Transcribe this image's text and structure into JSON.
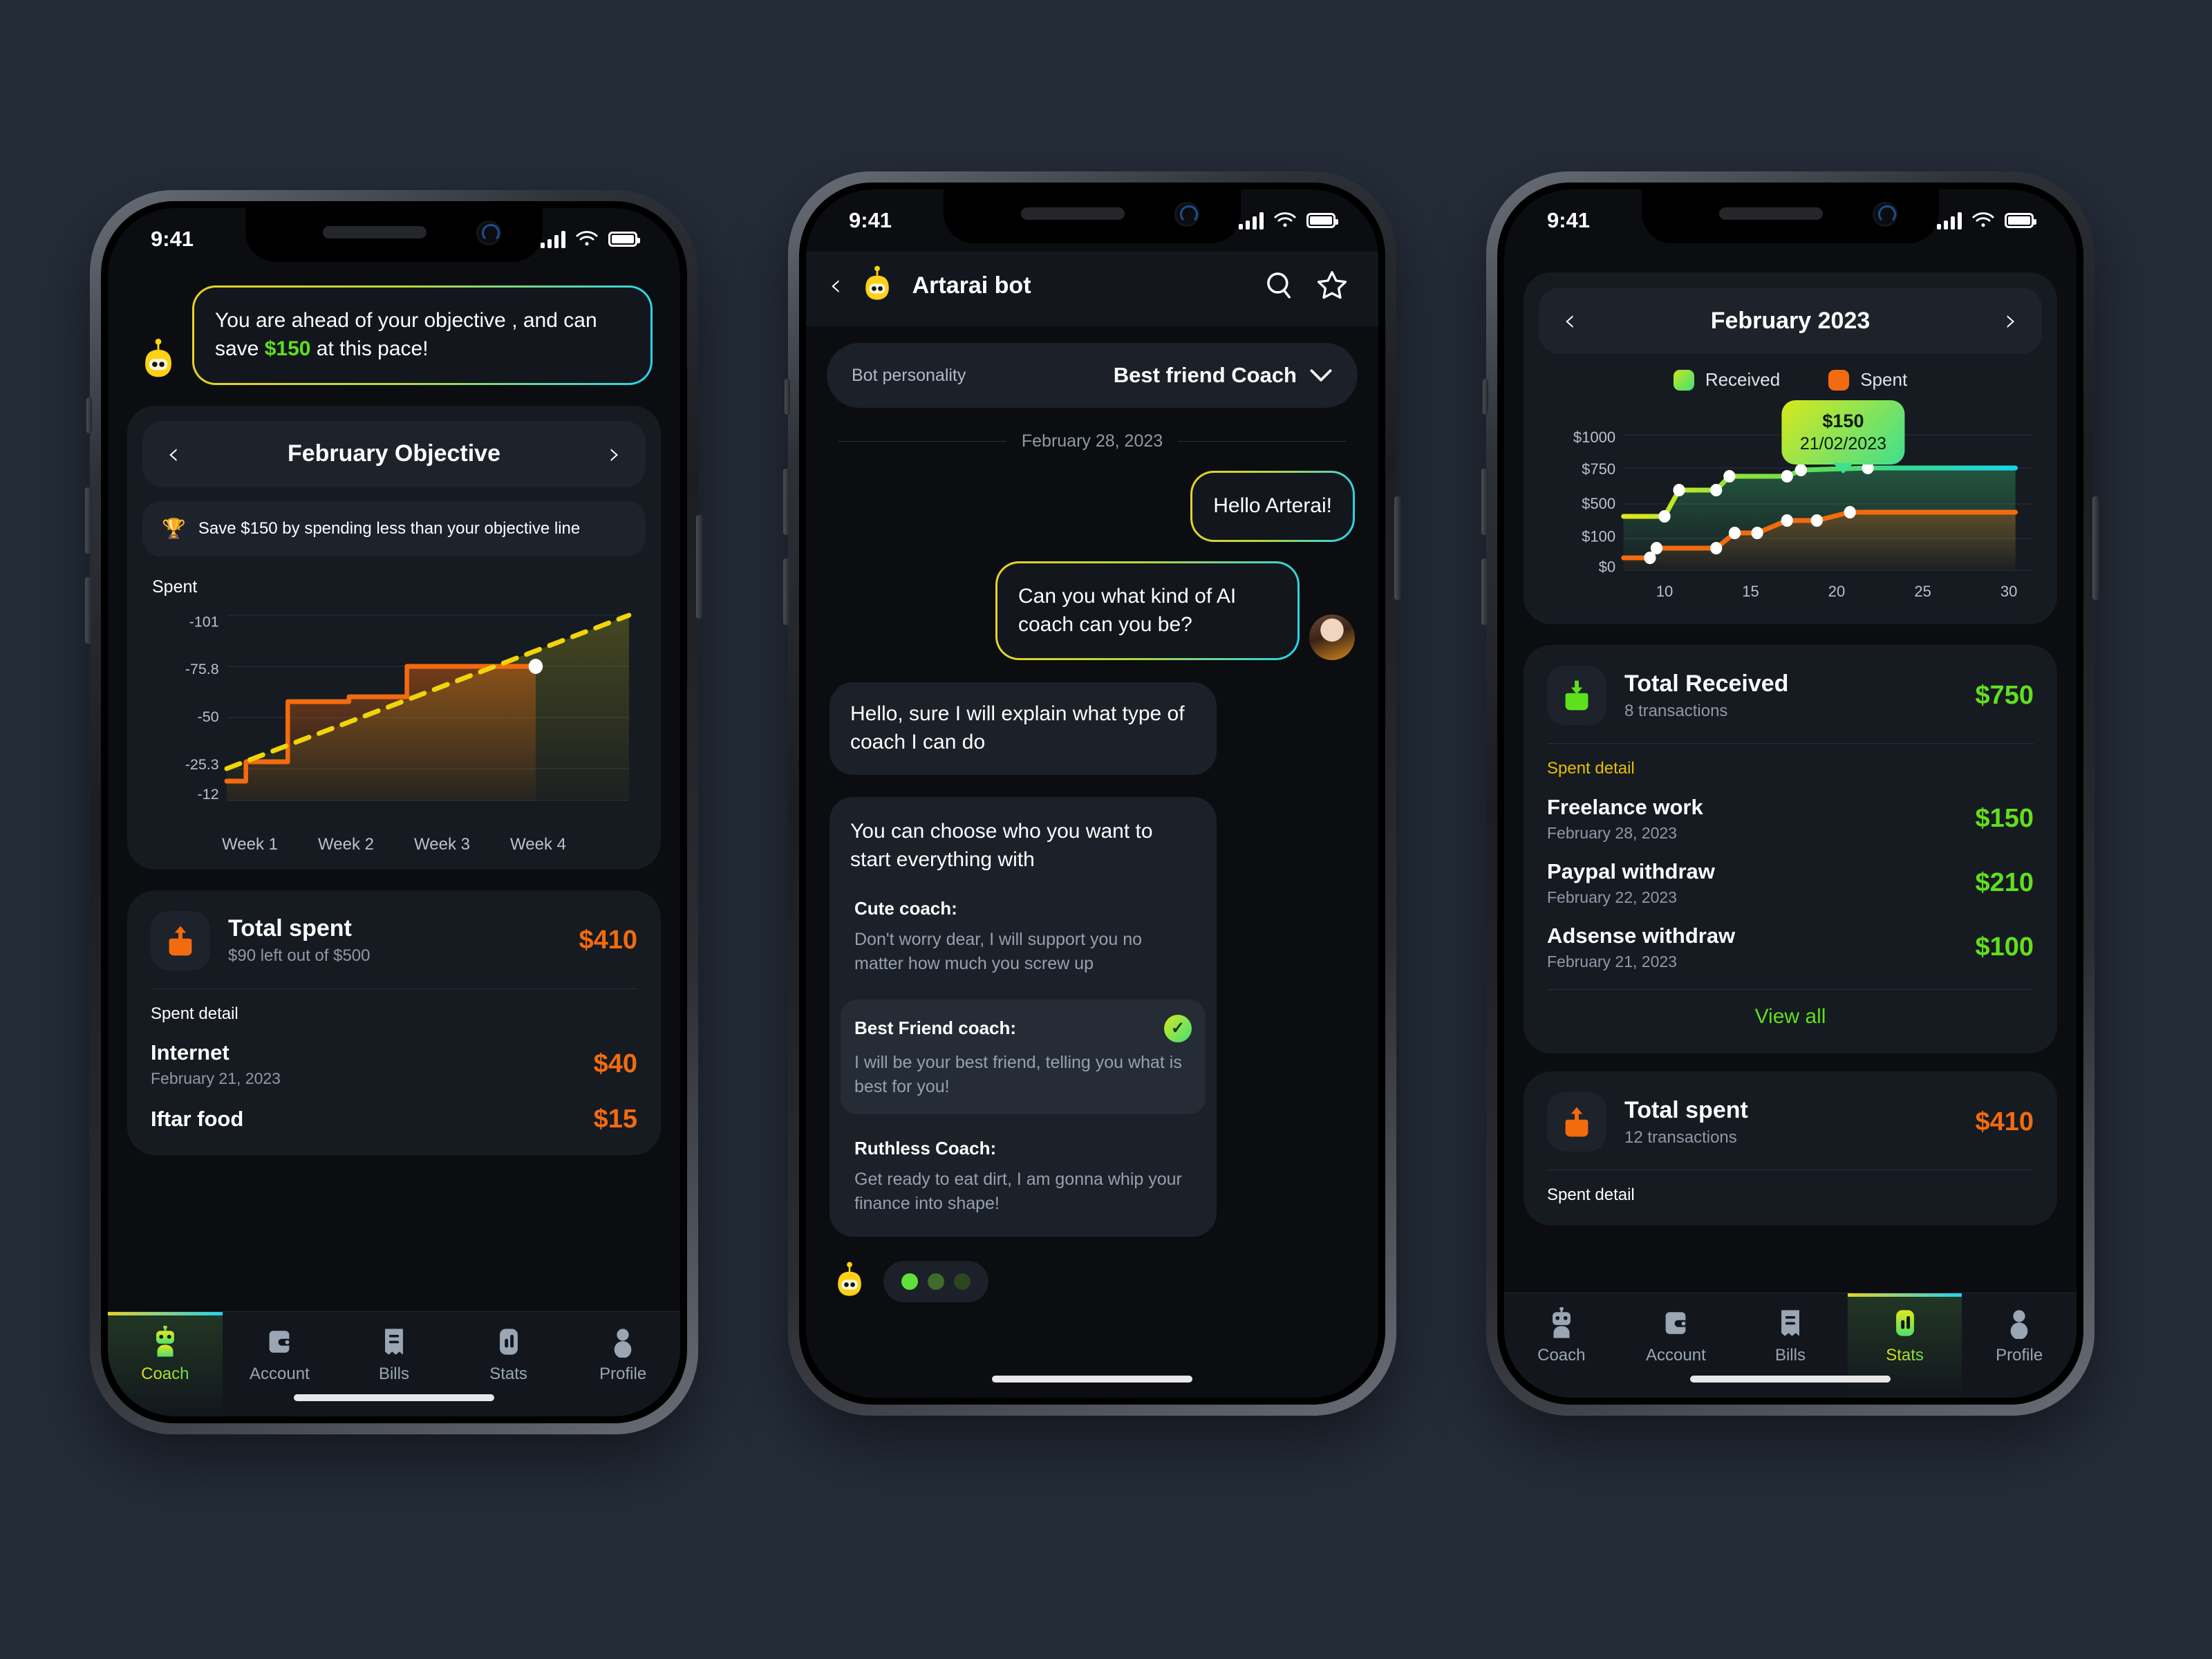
{
  "theme": {
    "page_bg": "#242c38",
    "screen_bg": "#0b0d10",
    "card_bg": "#161a21",
    "accent_green": "#5fe01d",
    "accent_orange": "#f26b0f",
    "accent_yellow": "#e8c000",
    "accent_cyan": "#22d3ee"
  },
  "status_bar": {
    "time": "9:41",
    "signal_icon": "cellular-bars-icon",
    "wifi_icon": "wifi-icon",
    "battery_icon": "battery-icon"
  },
  "phone1": {
    "coach_message": {
      "avatar_icon": "bot-avatar-icon",
      "text_before": "You are ahead of your objective , and can save ",
      "highlight": "$150",
      "text_after": " at this pace!"
    },
    "objective_card": {
      "prev_icon": "chevron-left-icon",
      "title": "February Objective",
      "next_icon": "chevron-right-icon",
      "goal_icon": "trophy-icon",
      "goal_text": "Save $150 by spending less than your objective line",
      "chart_label": "Spent"
    },
    "total_spent": {
      "icon": "arrow-up-out-icon",
      "title": "Total spent",
      "subtitle": "$90 left out of $500",
      "amount": "$410"
    },
    "spent_detail_label": "Spent detail",
    "transactions": [
      {
        "name": "Internet",
        "date": "February 21, 2023",
        "amount": "$40"
      },
      {
        "name": "Iftar food",
        "date": "",
        "amount": "$15"
      }
    ],
    "tabs": [
      {
        "label": "Coach",
        "icon": "robot-icon",
        "active": true
      },
      {
        "label": "Account",
        "icon": "wallet-icon",
        "active": false
      },
      {
        "label": "Bills",
        "icon": "receipt-icon",
        "active": false
      },
      {
        "label": "Stats",
        "icon": "bar-chart-icon",
        "active": false
      },
      {
        "label": "Profile",
        "icon": "person-icon",
        "active": false
      }
    ]
  },
  "phone2": {
    "header": {
      "back_icon": "chevron-left-icon",
      "avatar_icon": "bot-avatar-icon",
      "title": "Artarai bot",
      "search_icon": "search-icon",
      "star_icon": "star-icon"
    },
    "personality": {
      "label": "Bot personality",
      "value": "Best friend Coach",
      "chevron_icon": "chevron-down-icon"
    },
    "date_separator": "February 28, 2023",
    "messages": [
      {
        "side": "right",
        "style": "gradient",
        "text": "Hello Arterai!"
      },
      {
        "side": "right",
        "style": "gradient",
        "text": "Can you what kind of AI coach can you be?",
        "avatar_icon": "user-avatar"
      },
      {
        "side": "left",
        "style": "dark",
        "text": "Hello, sure I will explain what type of coach I can do"
      }
    ],
    "options_card": {
      "heading": "You can choose who you want to start everything with",
      "options": [
        {
          "name": "Cute coach:",
          "desc": "Don't worry dear, I will support you no matter how much you screw up",
          "selected": false
        },
        {
          "name": "Best Friend coach:",
          "desc": "I will be your best friend, telling you what is best for you!",
          "selected": true,
          "check_icon": "check-icon"
        },
        {
          "name": "Ruthless Coach:",
          "desc": "Get ready to eat dirt, I am gonna whip your finance into shape!",
          "selected": false
        }
      ]
    },
    "typing_indicator": {
      "avatar_icon": "bot-avatar-icon",
      "dots": 3
    }
  },
  "phone3": {
    "month_selector": {
      "prev_icon": "chevron-left-icon",
      "title": "February 2023",
      "next_icon": "chevron-right-icon"
    },
    "tooltip": {
      "amount": "$150",
      "date": "21/02/2023"
    },
    "total_received": {
      "icon": "arrow-down-in-icon",
      "title": "Total Received",
      "subtitle": "8 transactions",
      "amount": "$750"
    },
    "spent_detail_label": "Spent detail",
    "transactions": [
      {
        "name": "Freelance work",
        "date": "February 28, 2023",
        "amount": "$150"
      },
      {
        "name": "Paypal withdraw",
        "date": "February 22, 2023",
        "amount": "$210"
      },
      {
        "name": "Adsense withdraw",
        "date": "February 21, 2023",
        "amount": "$100"
      }
    ],
    "view_all": "View all",
    "total_spent": {
      "icon": "arrow-up-out-icon",
      "title": "Total spent",
      "subtitle": "12 transactions",
      "amount": "$410"
    },
    "spent_detail_label2": "Spent detail",
    "tabs": [
      {
        "label": "Coach",
        "icon": "robot-icon",
        "active": false
      },
      {
        "label": "Account",
        "icon": "wallet-icon",
        "active": false
      },
      {
        "label": "Bills",
        "icon": "receipt-icon",
        "active": false
      },
      {
        "label": "Stats",
        "icon": "bar-chart-icon",
        "active": true
      },
      {
        "label": "Profile",
        "icon": "person-icon",
        "active": false
      }
    ]
  },
  "chart_data": [
    {
      "id": "objective_chart",
      "type": "area",
      "title": "Spent",
      "xlabel": "",
      "ylabel": "Spent",
      "categories": [
        "Week 1",
        "Week 2",
        "Week 3",
        "Week 4"
      ],
      "ytick_labels": [
        "-101",
        "-75.8",
        "-50",
        "-25.3",
        "-12"
      ],
      "ytick_values": [
        -101,
        -75.8,
        -50,
        -25.3,
        -12
      ],
      "ylim": [
        -12,
        -110
      ],
      "grid": true,
      "legend": "none",
      "series": [
        {
          "name": "Spent",
          "color": "#f26b0f",
          "style": "step",
          "values": [
            -18,
            -18,
            -31,
            -31,
            -60,
            -60,
            -60,
            -72,
            -72
          ]
        },
        {
          "name": "Objective line",
          "color": "#f2d40a",
          "style": "dashed-linear",
          "values": [
            -25.3,
            -101
          ]
        }
      ],
      "marker_last": {
        "x": "Week 4",
        "color": "#ffffff"
      }
    },
    {
      "id": "stats_chart",
      "type": "area",
      "title": "February 2023",
      "xlabel": "",
      "ylabel": "",
      "xtick_labels": [
        "10",
        "15",
        "20",
        "25",
        "30"
      ],
      "ytick_labels": [
        "$0",
        "$100",
        "$500",
        "$750",
        "$1000"
      ],
      "ytick_values": [
        0,
        100,
        500,
        750,
        1000
      ],
      "ylim": [
        0,
        1000
      ],
      "xlim": [
        7,
        31
      ],
      "grid": true,
      "legend": "top-center",
      "annotation": {
        "label": "$150",
        "sublabel": "21/02/2023",
        "x": 26,
        "y": 750
      },
      "series": [
        {
          "name": "Received",
          "color": "#8fe03a",
          "gradient": [
            "#d7e81e",
            "#22d3ee"
          ],
          "points": [
            {
              "x": 7,
              "y": 400
            },
            {
              "x": 11,
              "y": 400
            },
            {
              "x": 12,
              "y": 560
            },
            {
              "x": 15,
              "y": 560
            },
            {
              "x": 16,
              "y": 660
            },
            {
              "x": 20,
              "y": 660
            },
            {
              "x": 21,
              "y": 700
            },
            {
              "x": 26,
              "y": 750
            },
            {
              "x": 31,
              "y": 750
            }
          ]
        },
        {
          "name": "Spent",
          "color": "#f26b0f",
          "points": [
            {
              "x": 7,
              "y": 50
            },
            {
              "x": 10,
              "y": 50
            },
            {
              "x": 10.5,
              "y": 90
            },
            {
              "x": 15,
              "y": 90
            },
            {
              "x": 16.5,
              "y": 180
            },
            {
              "x": 18,
              "y": 180
            },
            {
              "x": 20.5,
              "y": 290
            },
            {
              "x": 23,
              "y": 290
            },
            {
              "x": 26,
              "y": 350
            },
            {
              "x": 31,
              "y": 350
            }
          ]
        }
      ]
    }
  ]
}
